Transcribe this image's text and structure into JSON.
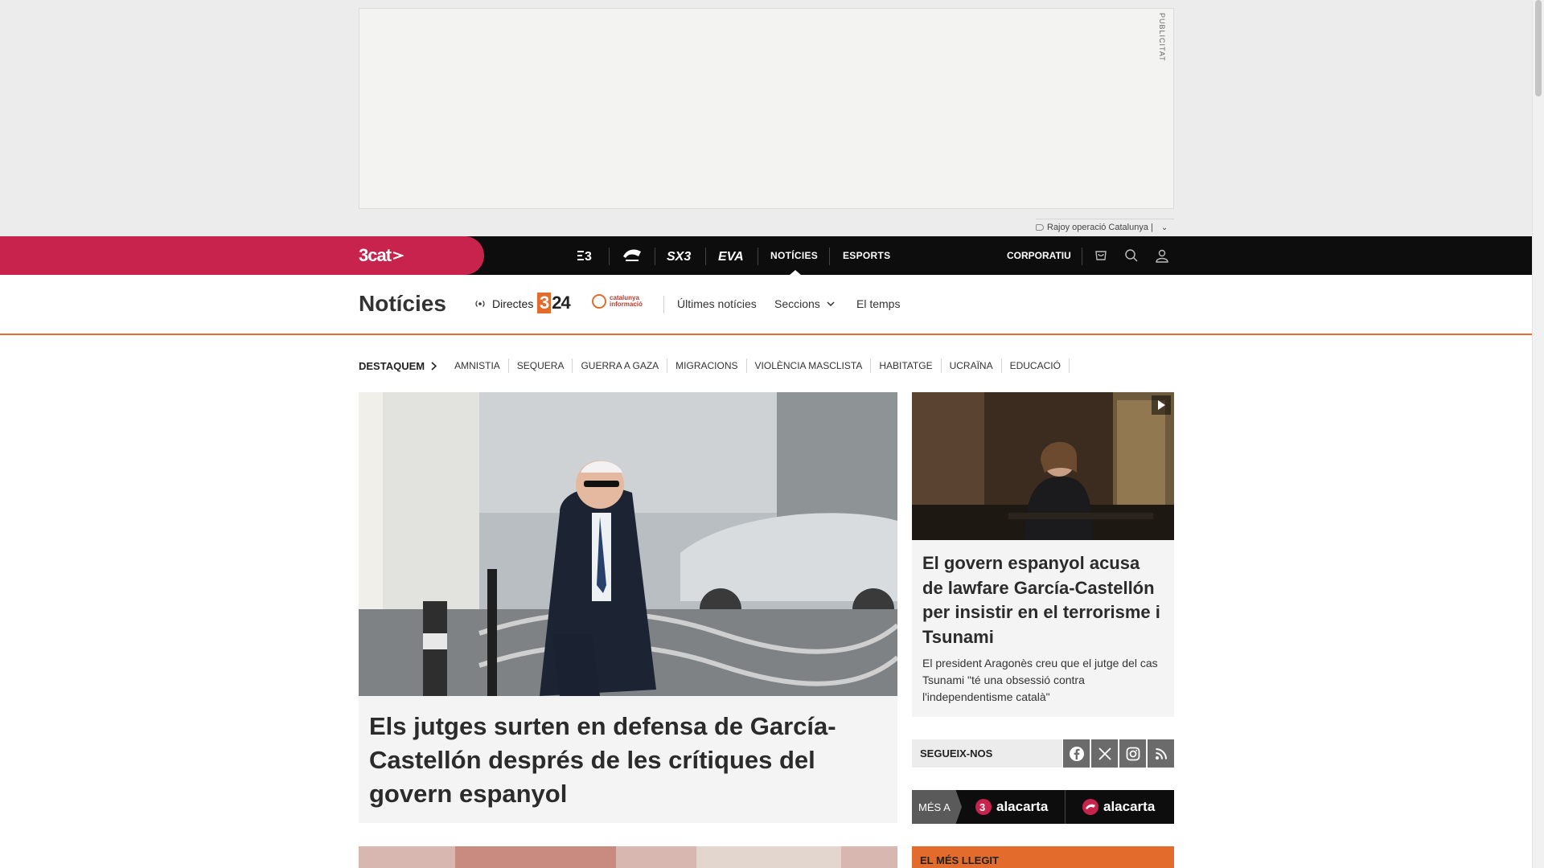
{
  "ad": {
    "label": "PUBLICITAT",
    "tagline": "Rajoy operació Catalunya |"
  },
  "topnav": {
    "brand": "3cat",
    "channels": [
      {
        "name": "tv3-icon",
        "label": "▸3"
      },
      {
        "name": "catradio-icon",
        "label": "Cat ràdio"
      },
      {
        "name": "sx3-icon",
        "label": "SX3"
      },
      {
        "name": "eva-icon",
        "label": "EVA"
      }
    ],
    "links": {
      "noticies": "NOTÍCIES",
      "esports": "ESPORTS",
      "corporatiu": "CORPORATIU"
    }
  },
  "section": {
    "title": "Notícies",
    "live_label": "Directes",
    "logo_324": "24",
    "logo_ci_line1": "catalunya",
    "logo_ci_line2": "informació",
    "links": {
      "ultimes": "Últimes notícies",
      "seccions": "Seccions",
      "temps": "El temps"
    }
  },
  "highlights": {
    "title": "DESTAQUEM",
    "items": [
      "AMNISTIA",
      "SEQUERA",
      "GUERRA A GAZA",
      "MIGRACIONS",
      "VIOLÈNCIA MASCLISTA",
      "HABITATGE",
      "UCRAÏNA",
      "EDUCACIÓ"
    ]
  },
  "main_article": {
    "headline": "Els jutges surten en defensa de García-Castellón després de les crítiques del govern espanyol"
  },
  "side_article": {
    "headline": "El govern espanyol acusa de lawfare García-Castellón per insistir en el terrorisme i Tsunami",
    "summary": "El president Aragonès creu que el jutge del cas Tsunami \"té una obsessió contra l'independentisme català\""
  },
  "follow": {
    "label": "SEGUEIX-NOS"
  },
  "mesa": {
    "label": "MÉS A",
    "alacarta_1": "alacarta",
    "alacarta_2": "alacarta"
  },
  "mesllegit": {
    "label": "EL MÉS LLEGIT"
  },
  "colors": {
    "brand_red": "#c7234c",
    "accent_orange": "#e36b2c",
    "nav_black": "#0d0d0d"
  }
}
